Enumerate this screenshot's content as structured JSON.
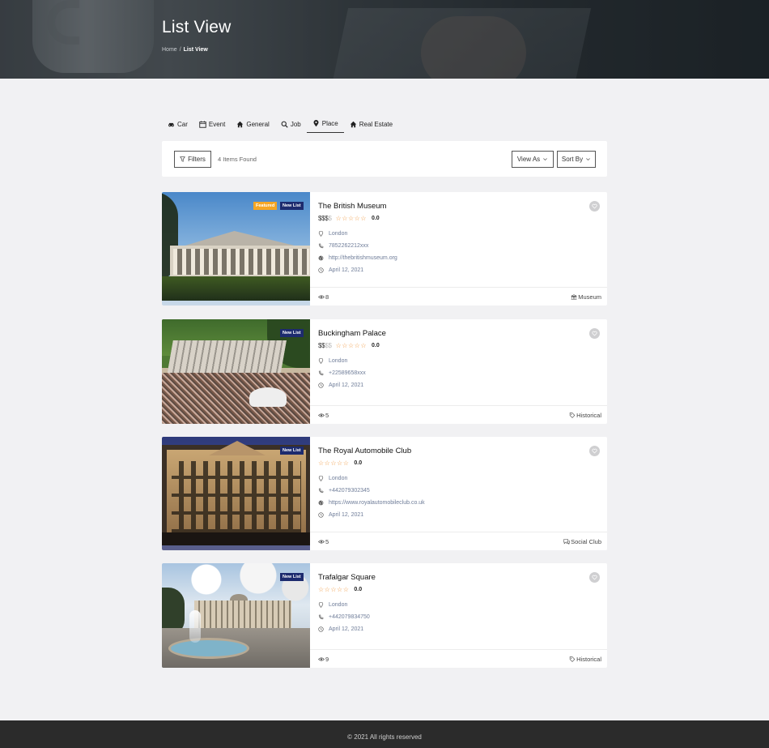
{
  "hero": {
    "title": "List View",
    "breadcrumb": {
      "home": "Home",
      "separator": "/",
      "current": "List View"
    }
  },
  "tabs": [
    {
      "label": "Car",
      "icon": "car-icon"
    },
    {
      "label": "Event",
      "icon": "calendar-icon"
    },
    {
      "label": "General",
      "icon": "home-icon"
    },
    {
      "label": "Job",
      "icon": "search-icon"
    },
    {
      "label": "Place",
      "icon": "map-pin-icon",
      "active": true
    },
    {
      "label": "Real Estate",
      "icon": "home-icon"
    }
  ],
  "toolbar": {
    "filters_label": "Filters",
    "items_found": "4 Items Found",
    "view_as_label": "View As",
    "sort_by_label": "Sort By"
  },
  "listings": [
    {
      "title": "The British Museum",
      "price_on": "$$$",
      "price_off": "$",
      "stars": "☆☆☆☆☆",
      "rating": "0.0",
      "location": "London",
      "phone": "7852262212xxx",
      "website": "http://thebritishmuseum.org",
      "date": "April 12, 2021",
      "views": "8",
      "category": "Museum",
      "badges": {
        "featured": "Featured",
        "new": "New List"
      }
    },
    {
      "title": "Buckingham Palace",
      "price_on": "$$",
      "price_off": "$$",
      "stars": "☆☆☆☆☆",
      "rating": "0.0",
      "location": "London",
      "phone": "+22589658xxx",
      "date": "April 12, 2021",
      "views": "5",
      "category": "Historical",
      "badges": {
        "new": "New List"
      }
    },
    {
      "title": "The Royal Automobile Club",
      "stars": "☆☆☆☆☆",
      "rating": "0.0",
      "location": "London",
      "phone": "+442079302345",
      "website": "https://www.royalautomobileclub.co.uk",
      "date": "April 12, 2021",
      "views": "5",
      "category": "Social Club",
      "badges": {
        "new": "New List"
      }
    },
    {
      "title": "Trafalgar Square",
      "stars": "☆☆☆☆☆",
      "rating": "0.0",
      "location": "London",
      "phone": "+442079834750",
      "date": "April 12, 2021",
      "views": "9",
      "category": "Historical",
      "badges": {
        "new": "New List"
      }
    }
  ],
  "footer": {
    "copyright": "© 2021 All rights reserved"
  },
  "colors": {
    "star": "#f0963c",
    "new_badge": "#1d2b6e",
    "featured_badge": "#f5a623",
    "info_text": "#6f7d99",
    "footer_bg": "#2b2b2b"
  }
}
